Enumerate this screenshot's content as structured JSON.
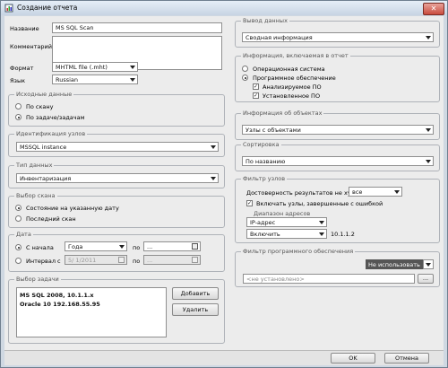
{
  "window": {
    "title": "Создание отчета",
    "close": "✕"
  },
  "left": {
    "name_label": "Название",
    "name_value": "MS SQL Scan",
    "comment_label": "Комментарий:",
    "format_label": "Формат",
    "format_value": "MHTML file (.mht)",
    "language_label": "Язык",
    "language_value": "Russian",
    "source_group": {
      "title": "Исходные данные",
      "options": [
        "По скану",
        "По задаче/задачам"
      ],
      "selected": 1
    },
    "host_ident_group": {
      "title": "Идентификация узлов",
      "value": "MSSQL instance"
    },
    "data_type_group": {
      "title": "Тип данных",
      "value": "Инвентаризация"
    },
    "scan_select_group": {
      "title": "Выбор скана",
      "options": [
        "Состояние на указанную дату",
        "Последний скан"
      ],
      "selected": 0
    },
    "date_group": {
      "title": "Дата",
      "from_start_label": "С начала",
      "from_start_value": "Года",
      "interval_label": "Интервал с",
      "interval_value": "5/ 1/2011",
      "to_label": "по",
      "to_value1": "...",
      "to_value2": "..."
    },
    "task_group": {
      "title": "Выбор задачи",
      "items": [
        "MS SQL 2008, 10.1.1.x",
        "Oracle 10 192.168.55.95"
      ],
      "add_label": "Добавить",
      "delete_label": "Удалить"
    }
  },
  "right": {
    "output_group": {
      "title": "Вывод данных",
      "value": "Сводная информация"
    },
    "info_group": {
      "title": "Информация, включаемая в отчет",
      "options": [
        "Операционная система",
        "Программное обеспечение"
      ],
      "selected": 1,
      "checks": [
        "Анализируемое ПО",
        "Установленное ПО"
      ]
    },
    "objects_group": {
      "title": "Информация об объектах",
      "value": "Узлы с объектами"
    },
    "sort_group": {
      "title": "Сортировка",
      "value": "По названию"
    },
    "host_filter_group": {
      "title": "Фильтр узлов",
      "reliability_label": "Достоверность результатов не хуже",
      "reliability_value": "все",
      "include_label": "Включать узлы, завершенные с ошибкой",
      "address_range_title": "Диапазон адресов",
      "addr_type_value": "IP-адрес",
      "include_value": "Включить",
      "range_value": "10.1.1.2"
    },
    "software_filter_group": {
      "title": "Фильтр программного обеспечения",
      "mode_value": "Не использовать",
      "not_set": "<не установлено>",
      "browse": "..."
    }
  },
  "buttons": {
    "ok": "OK",
    "cancel": "Отмена"
  }
}
